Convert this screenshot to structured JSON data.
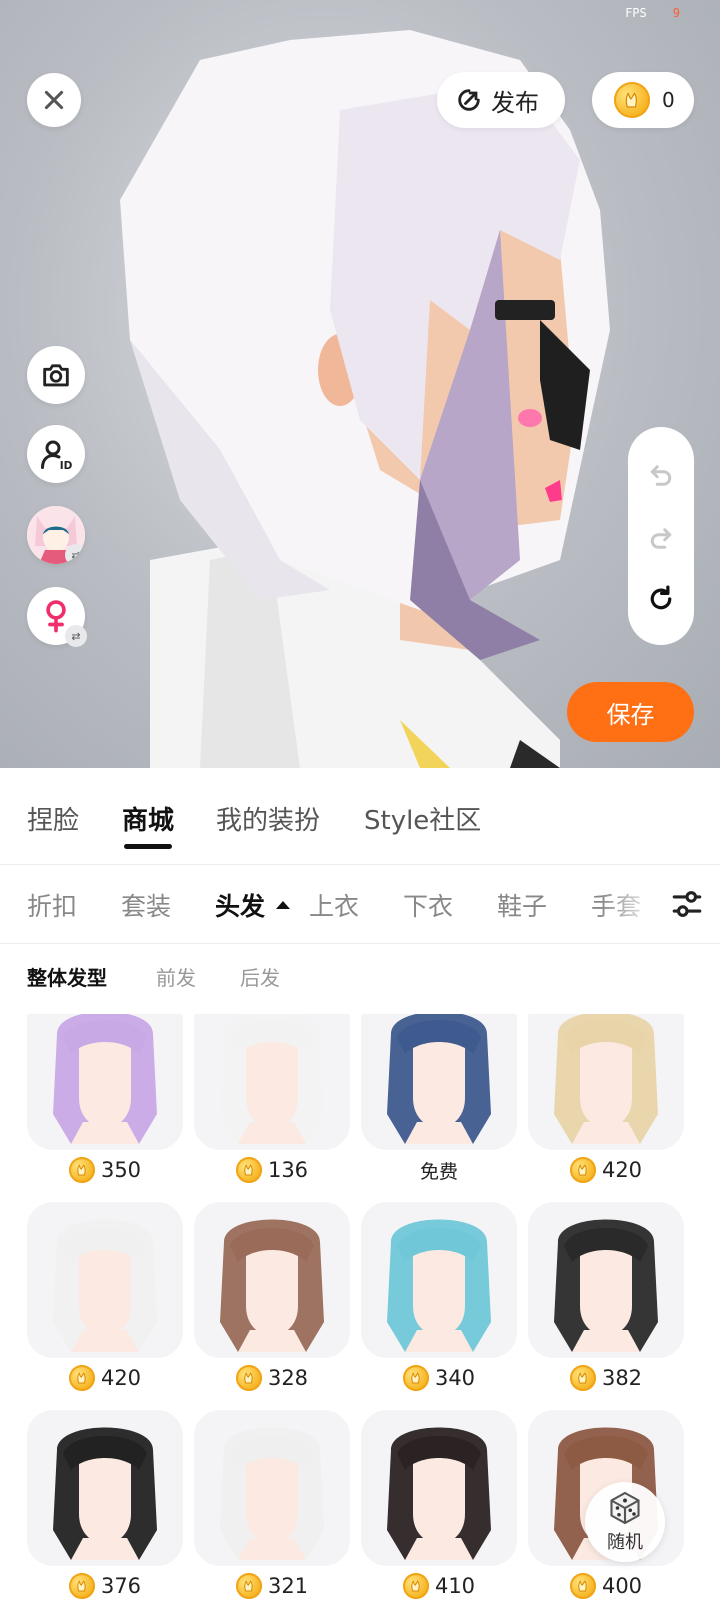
{
  "status": {
    "fps_label": "FPS",
    "fps_value": "9"
  },
  "top": {
    "publish_label": "发布",
    "coin_balance": "0"
  },
  "actions": {
    "save_label": "保存",
    "random_label": "随机"
  },
  "main_tabs": [
    "捏脸",
    "商城",
    "我的装扮",
    "Style社区"
  ],
  "category_tabs": [
    "折扣",
    "套装",
    "头发",
    "上衣",
    "下衣",
    "鞋子",
    "手套"
  ],
  "sub_tabs": [
    "整体发型",
    "前发",
    "后发"
  ],
  "items": [
    {
      "price": "350",
      "hair_color": "#c9a8e6"
    },
    {
      "price": "136",
      "hair_color": "#f2f2f2"
    },
    {
      "price": "免费",
      "hair_color": "#3e5a8e"
    },
    {
      "price": "420",
      "hair_color": "#e8d4a8"
    },
    {
      "price": "420",
      "hair_color": "#f0f0f0"
    },
    {
      "price": "328",
      "hair_color": "#9a6b58"
    },
    {
      "price": "340",
      "hair_color": "#6fc7d8"
    },
    {
      "price": "382",
      "hair_color": "#2a2a2a"
    },
    {
      "price": "376",
      "hair_color": "#222222"
    },
    {
      "price": "321",
      "hair_color": "#efefef"
    },
    {
      "price": "410",
      "hair_color": "#2b2323"
    },
    {
      "price": "400",
      "hair_color": "#8d5a44"
    }
  ],
  "colors": {
    "accent": "#ff6f14",
    "coin": "#f6b21e"
  }
}
